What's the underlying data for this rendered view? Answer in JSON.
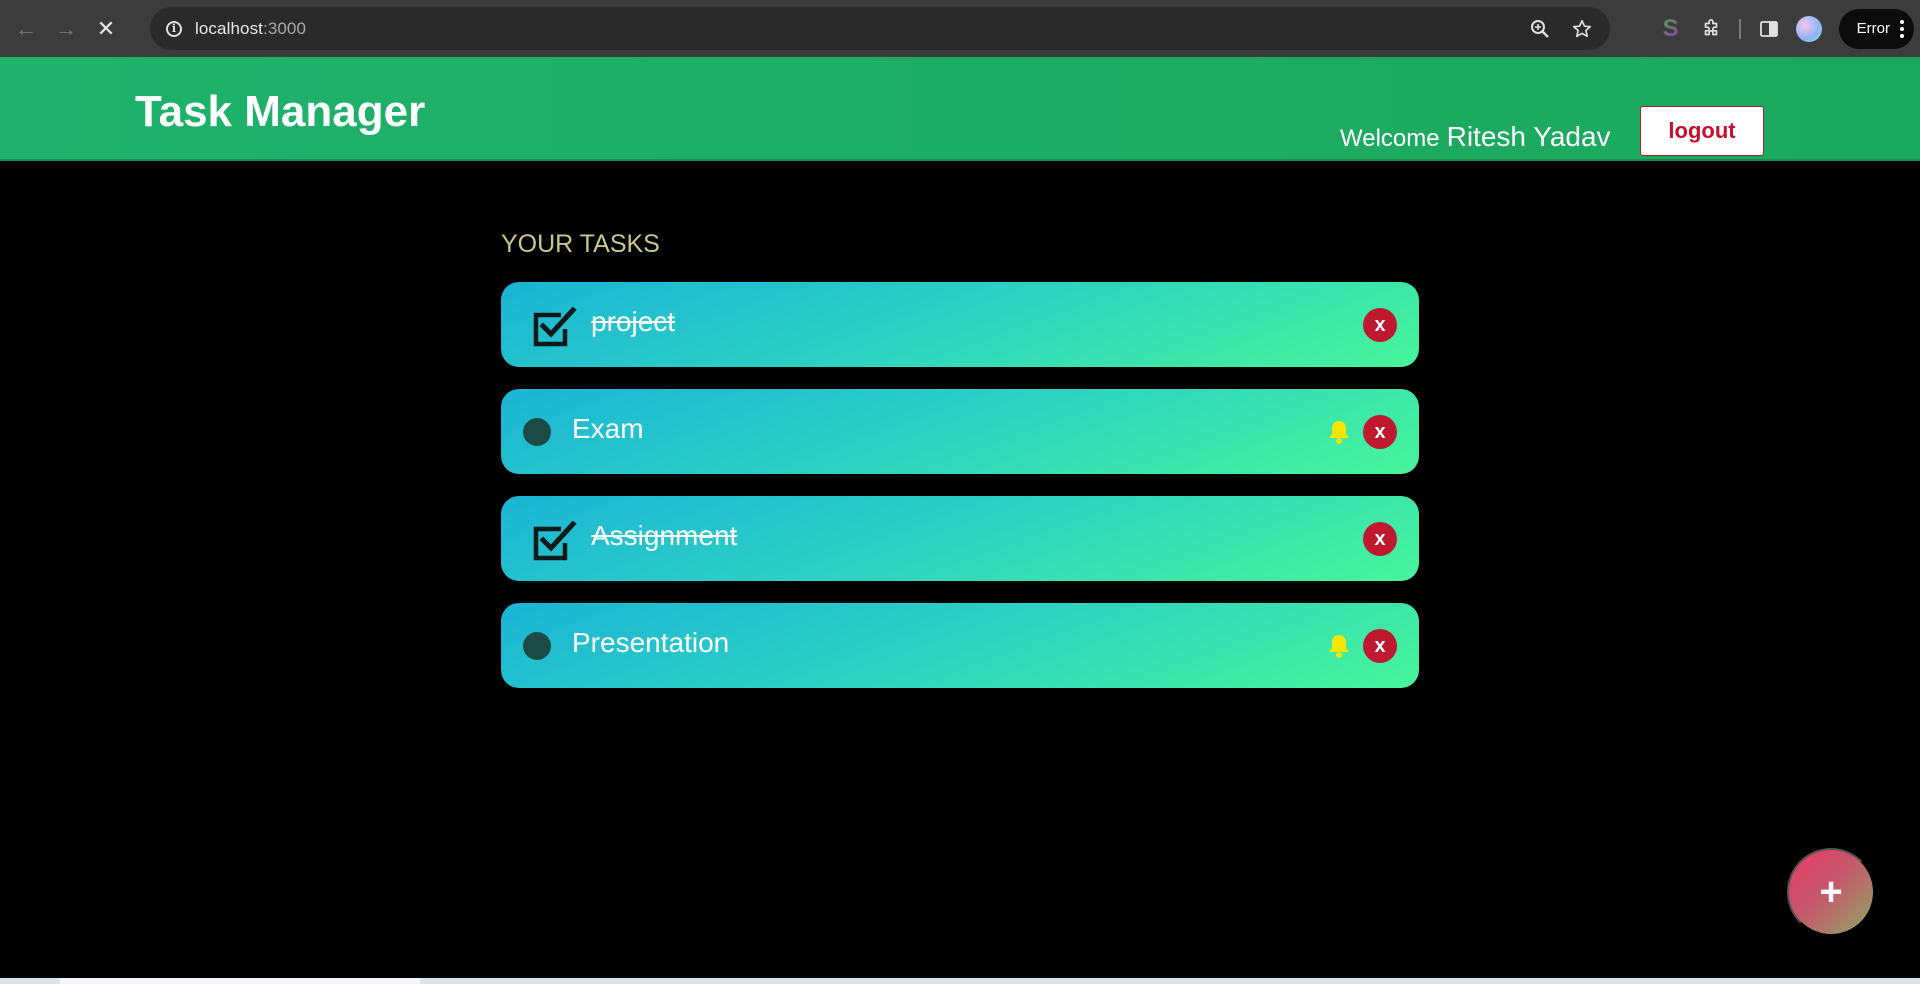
{
  "browser": {
    "url_host": "localhost",
    "url_port": ":3000",
    "error_label": "Error",
    "icons": [
      "back-icon",
      "forward-icon",
      "stop-icon",
      "site-info-icon",
      "zoom-icon",
      "star-icon",
      "extension-s-icon",
      "puzzle-icon",
      "sidebar-icon",
      "avatar-icon",
      "kebab-icon"
    ]
  },
  "header": {
    "title": "Task Manager",
    "welcome_label": "Welcome",
    "user_name": "Ritesh Yadav",
    "logout_label": "logout",
    "background_color": "#1fb26c"
  },
  "main": {
    "heading": "YOUR TASKS",
    "tasks": [
      {
        "title": "project",
        "completed": true,
        "reminder": false,
        "delete_label": "x"
      },
      {
        "title": "Exam",
        "completed": false,
        "reminder": true,
        "delete_label": "x"
      },
      {
        "title": "Assignment",
        "completed": true,
        "reminder": false,
        "delete_label": "x"
      },
      {
        "title": "Presentation",
        "completed": false,
        "reminder": true,
        "delete_label": "x"
      }
    ]
  },
  "fab": {
    "label": "+"
  },
  "colors": {
    "delete": "#c0182f",
    "bell": "#f5e600",
    "heading": "#c9c78a"
  }
}
